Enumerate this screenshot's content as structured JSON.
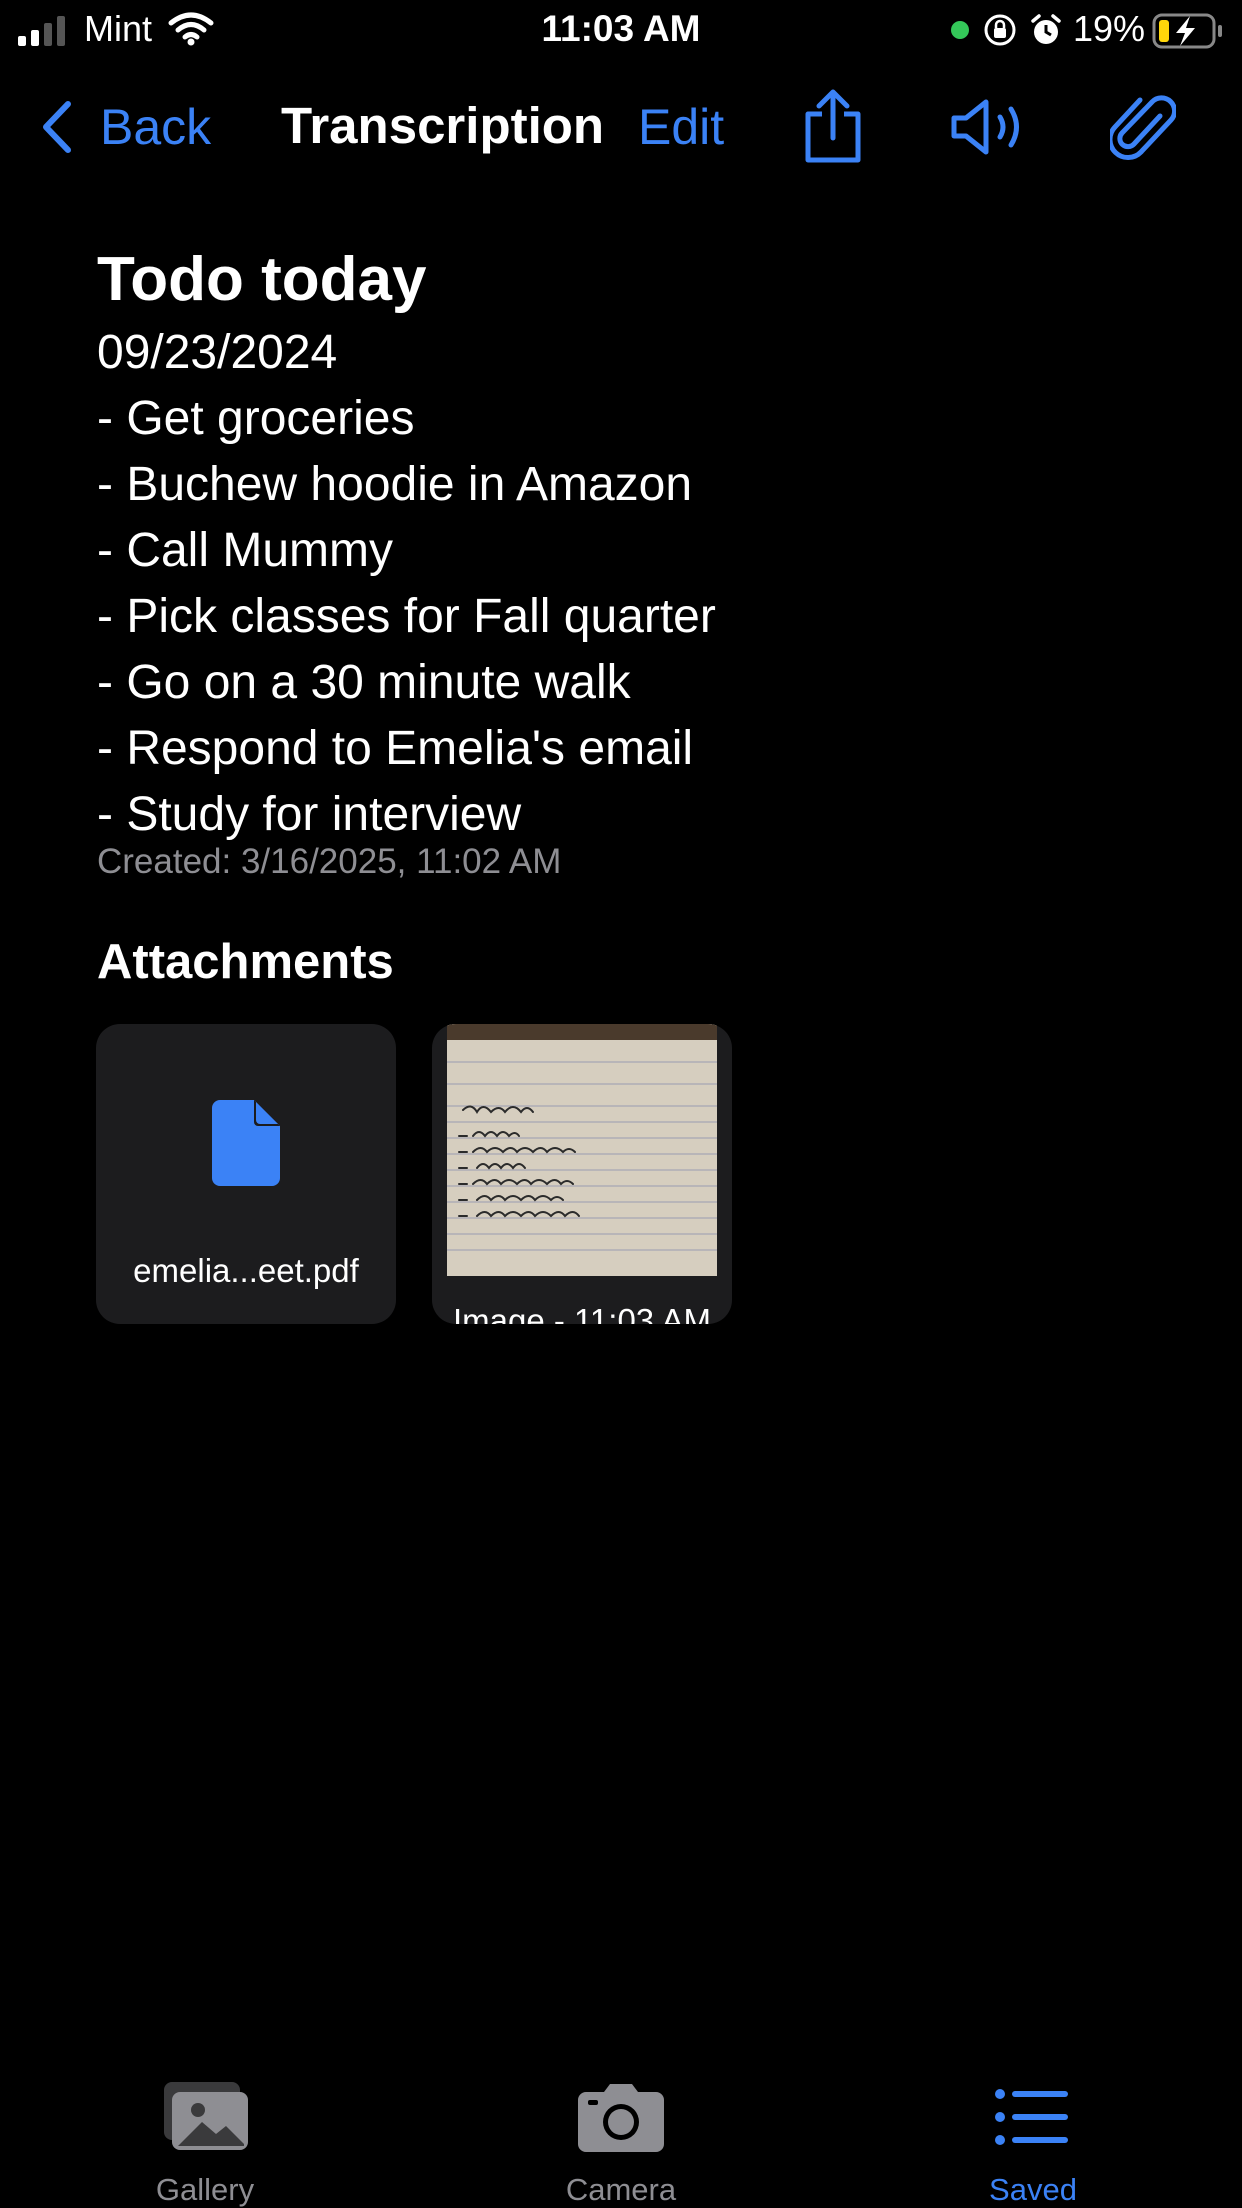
{
  "status_bar": {
    "carrier": "Mint",
    "time": "11:03 AM",
    "battery": "19%"
  },
  "nav": {
    "back_label": "Back",
    "title": "Transcription",
    "edit_label": "Edit",
    "icons": [
      "share-icon",
      "speaker-icon",
      "paperclip-icon"
    ]
  },
  "note": {
    "title": "Todo today",
    "lines": [
      "09/23/2024",
      "- Get groceries",
      "- Buchew hoodie in Amazon",
      "- Call Mummy",
      "- Pick classes for Fall quarter",
      "- Go on a 30 minute walk",
      "- Respond to Emelia's email",
      "- Study for interview"
    ],
    "created": "Created: 3/16/2025, 11:02 AM"
  },
  "attachments": {
    "heading": "Attachments",
    "items": [
      {
        "name": "emelia...eet.pdf",
        "icon": "document-icon"
      },
      {
        "name": "Image - 11:03 AM",
        "icon": "image-thumbnail"
      }
    ]
  },
  "tab_bar": {
    "tabs": [
      {
        "label": "Gallery",
        "icon": "gallery-icon"
      },
      {
        "label": "Camera",
        "icon": "camera-icon"
      },
      {
        "label": "Saved",
        "icon": "list-icon"
      }
    ],
    "active_color": "#3b82f6",
    "inactive_color": "#8e8e93"
  },
  "colors": {
    "accent": "#3b82f6",
    "background": "#000000",
    "card": "#1c1c1e"
  }
}
